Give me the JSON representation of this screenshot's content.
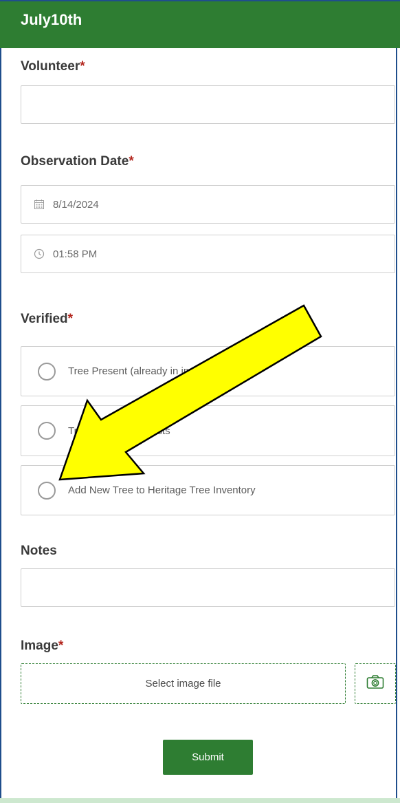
{
  "header": {
    "title": "July10th"
  },
  "volunteer": {
    "label": "Volunteer",
    "required_mark": "*",
    "value": ""
  },
  "observation_date": {
    "label": "Observation Date",
    "required_mark": "*",
    "date_value": "8/14/2024",
    "time_value": "01:58 PM",
    "date_icon": "calendar-icon",
    "time_icon": "clock-icon"
  },
  "verified": {
    "label": "Verified",
    "required_mark": "*",
    "options": [
      {
        "label": "Tree Present (already in inventory)"
      },
      {
        "label": "Tree No Longer Exists"
      },
      {
        "label": "Add New Tree to Heritage Tree Inventory"
      }
    ]
  },
  "notes": {
    "label": "Notes",
    "value": ""
  },
  "image": {
    "label": "Image",
    "required_mark": "*",
    "select_label": "Select image file",
    "camera_icon": "camera-icon"
  },
  "submit": {
    "label": "Submit"
  },
  "annotation": {
    "arrow_color": "#ffff00",
    "arrow_outline": "#000000"
  },
  "colors": {
    "brand_green": "#2e7d32",
    "required_red": "#b3261e",
    "frame_blue": "#1f4e8c"
  }
}
